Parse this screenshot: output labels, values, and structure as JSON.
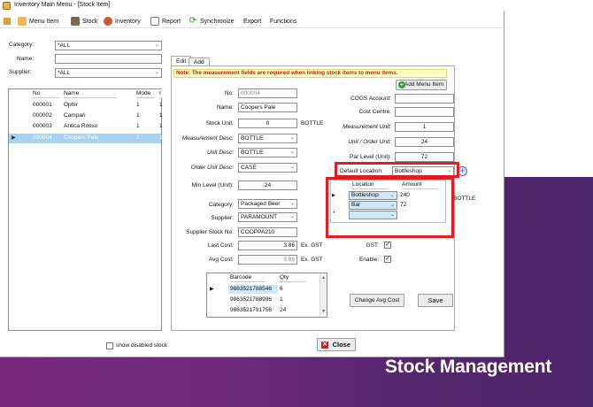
{
  "window": {
    "title": "Inventory Main Menu - [Stock Item]"
  },
  "menu": [
    "Menu Item",
    "Stock",
    "Inventory",
    "Report",
    "Synchronize",
    "Export",
    "Functions"
  ],
  "filters": {
    "category_label": "Category:",
    "category_value": "*ALL",
    "name_label": "Name:",
    "name_value": "",
    "supplier_label": "Supplier:",
    "supplier_value": "*ALL"
  },
  "stock_list": {
    "headers": [
      "No",
      "Name",
      "Mode",
      "I"
    ],
    "rows": [
      [
        "000001",
        "Ophir",
        "1",
        "1"
      ],
      [
        "000002",
        "Campari",
        "1",
        "1"
      ],
      [
        "000003",
        "Antica Rosso",
        "1",
        "1"
      ],
      [
        "000004",
        "Coopers Pale",
        "1",
        "1"
      ]
    ]
  },
  "show_disabled_label": "show disabled stock",
  "tabs": [
    "Edit",
    "Add"
  ],
  "note": "Note: The measurement fields are required when linking stock items to menu items.",
  "add_menu_item_label": "Add Menu Item",
  "form": {
    "no_label": "No:",
    "no": "000004",
    "name_label": "Name:",
    "name": "Coopers Pale",
    "stock_unit_label": "Stock Unit:",
    "stock_unit": "0",
    "stock_unit_suffix": "BOTTLE",
    "measurement_desc_label": "Measurement Desc:",
    "measurement_desc": "BOTTLE",
    "unit_desc_label": "Unit Desc:",
    "unit_desc": "BOTTLE",
    "order_unit_desc_label": "Order Unit Desc:",
    "order_unit_desc": "CASE",
    "min_level_label": "Min Level (Unit):",
    "min_level": "24",
    "category_label": "Category:",
    "category": "Packaged Beer",
    "supplier_label": "Supplier:",
    "supplier": "PARAMOUNT",
    "supplier_stock_no_label": "Supplier Stock No:",
    "supplier_stock_no": "COOPPA210",
    "last_cost_label": "Last Cost:",
    "last_cost": "3.86",
    "last_cost_suffix": "Ex. GST",
    "avg_cost_label": "Avg Cost:",
    "avg_cost": "3.86",
    "avg_cost_suffix": "Ex. GST",
    "cogs_label": "COGS Account:",
    "cogs": "",
    "cost_centre_label": "Cost Centre:",
    "cost_centre": "",
    "measurement_unit_label": "Measurement Unit:",
    "measurement_unit": "1",
    "unit_order_unit_label": "Unit / Order Unit:",
    "unit_order_unit": "24",
    "par_level_label": "Par Level (Unit):",
    "par_level": "72",
    "default_location_label": "Default Location:",
    "default_location": "Bottleshop",
    "gst_label": "GST:",
    "gst_checked": "✓",
    "enable_label": "Enable:",
    "enable_checked": "✓"
  },
  "location_grid": {
    "headers": [
      "Location",
      "Amount"
    ],
    "rows": [
      [
        "Bottleshop",
        "240"
      ],
      [
        "Bar",
        "72"
      ],
      [
        "",
        ""
      ]
    ],
    "suffix": "BOTTLE"
  },
  "barcode_grid": {
    "headers": [
      "Barcode",
      "Qty"
    ],
    "rows": [
      [
        "9863521788546",
        "6"
      ],
      [
        "9863521788996",
        "1"
      ],
      [
        "9863521791756",
        "24"
      ]
    ]
  },
  "buttons": {
    "change_avg_cost": "Change Avg Cost",
    "save": "Save",
    "close": "Close"
  },
  "brand": "Stock Management",
  "colors": {
    "highlight": "#e51b24",
    "background": "#6c2a78",
    "note_text": "#d01515"
  }
}
